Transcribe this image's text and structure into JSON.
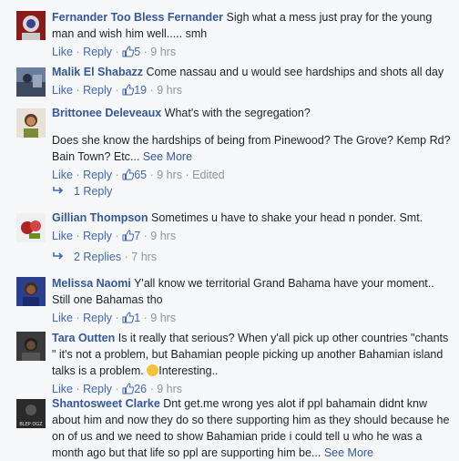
{
  "comments": [
    {
      "author": "Fernander Too Bless Fernander",
      "text": "Sigh what a mess just pray for the young man and wish him well..... smh",
      "like": "Like",
      "reply": "Reply",
      "likes": "5",
      "time": "9 hrs"
    },
    {
      "author": "Malik El Shabazz",
      "text": "Come nassau and u would see hardships and shots all day",
      "like": "Like",
      "reply": "Reply",
      "likes": "19",
      "time": "9 hrs"
    },
    {
      "author": "Brittonee Deleveaux",
      "text": "What's with the segregation?",
      "text2": "Does she know the hardships of being from Pinewood? The Grove? Kemp Rd? Bain Town? Etc...",
      "see_more": "See More",
      "like": "Like",
      "reply": "Reply",
      "likes": "65",
      "time": "9 hrs",
      "edited": "Edited",
      "replies_label": "1 Reply"
    },
    {
      "author": "Gillian Thompson",
      "text": "Sometimes u have to shake your head n ponder. Smt.",
      "like": "Like",
      "reply": "Reply",
      "likes": "7",
      "time": "9 hrs",
      "replies_label": "2 Replies",
      "replies_time": "7 hrs"
    },
    {
      "author": "Melissa Naomi",
      "text": "Y'all know we territorial Grand Bahama have your moment.. Still one Bahamas tho",
      "like": "Like",
      "reply": "Reply",
      "likes": "1",
      "time": "9 hrs"
    },
    {
      "author": "Tara Outten",
      "text": "Is it really that serious? When y'all pick up other countries \"chants \" it's not a problem, but Bahamian people picking up another Bahamian island talks is a problem.",
      "text_end": "Interesting..",
      "like": "Like",
      "reply": "Reply",
      "likes": "26",
      "time": "9 hrs"
    },
    {
      "author": "Shantosweet Clarke",
      "text": "Dnt get.me wrong yes alot if ppl bahamain didnt knw about him and now they do so there supporting him as they should because he on of us and we need to show Bahamian pride i could tell u who he was a month ago but that life so ppl are supporting him be...",
      "see_more": "See More",
      "avatar_text": "BLEP OGZ"
    }
  ],
  "separator": "·"
}
